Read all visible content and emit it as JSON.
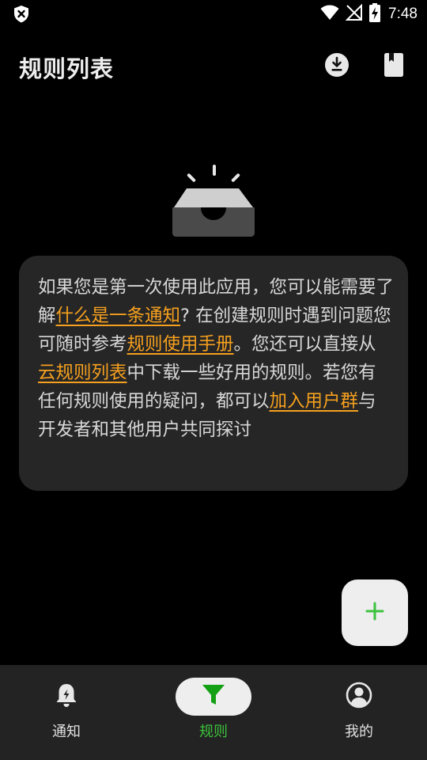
{
  "status_bar": {
    "time": "7:48",
    "icons": [
      "shield-x-icon",
      "wifi-icon",
      "signal-off-icon",
      "battery-charging-icon"
    ]
  },
  "app_bar": {
    "title": "规则列表",
    "actions": [
      "import-download-icon",
      "manual-book-icon"
    ]
  },
  "empty_state": {
    "icon": "empty-inbox-icon",
    "segments": [
      {
        "text": "如果您是第一次使用此应用，您可以能需要了解",
        "link": false
      },
      {
        "text": "什么是一条通知",
        "link": true
      },
      {
        "text": "? 在创建规则时遇到问题您可随时参考",
        "link": false
      },
      {
        "text": "规则使用手册",
        "link": true
      },
      {
        "text": "。您还可以直接从",
        "link": false
      },
      {
        "text": "云规则列表",
        "link": true
      },
      {
        "text": "中下载一些好用的规则。若您有任何规则使用的疑问，都可以",
        "link": false
      },
      {
        "text": "加入用户群",
        "link": true
      },
      {
        "text": "与开发者和其他用户共同探讨",
        "link": false
      }
    ]
  },
  "fab": {
    "icon": "plus-icon"
  },
  "bottom_nav": {
    "items": [
      {
        "label": "通知",
        "icon": "bell-icon",
        "selected": false
      },
      {
        "label": "规则",
        "icon": "filter-icon",
        "selected": true
      },
      {
        "label": "我的",
        "icon": "account-icon",
        "selected": false
      }
    ]
  },
  "colors": {
    "background": "#000000",
    "card": "#262626",
    "link": "#f6a01e",
    "accent_green": "#3cc23c",
    "nav_bar": "#232323"
  }
}
